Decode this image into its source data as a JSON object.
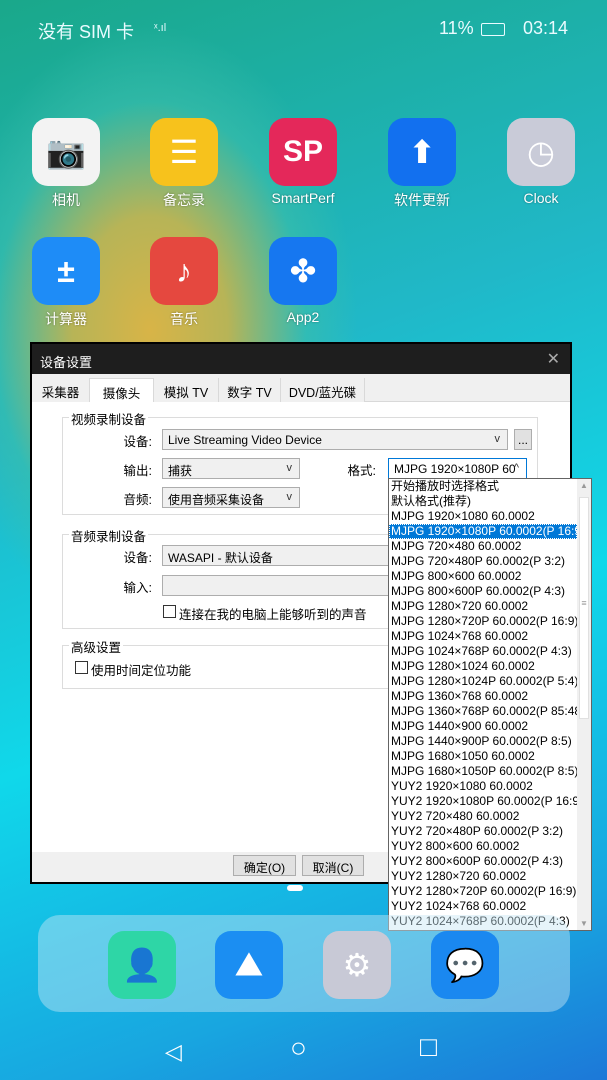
{
  "status_bar": {
    "carrier": "没有 SIM 卡",
    "battery": "11%",
    "time": "03:14"
  },
  "apps": [
    {
      "label": "相机",
      "icon": "camera-icon",
      "color": "#f3f3f3"
    },
    {
      "label": "备忘录",
      "icon": "notepad-icon",
      "color": "#f7c21c"
    },
    {
      "label": "SmartPerf",
      "icon": "smartperf-icon",
      "color": "#e4285a",
      "glyph": "SP"
    },
    {
      "label": "软件更新",
      "icon": "upload-arrow-icon",
      "color": "#1270ef"
    },
    {
      "label": "Clock",
      "icon": "clock-icon",
      "color": "#c9cbd8"
    },
    {
      "label": "计算器",
      "icon": "calculator-icon",
      "color": "#1e8cf7"
    },
    {
      "label": "音乐",
      "icon": "music-icon",
      "color": "#e5483f"
    },
    {
      "label": "App2",
      "icon": "grid-app-icon",
      "color": "#1677f0"
    }
  ],
  "dialog": {
    "title": "设备设置",
    "tabs": [
      "采集器",
      "摄像头",
      "模拟 TV",
      "数字 TV",
      "DVD/蓝光碟"
    ],
    "video_group": {
      "title": "视频录制设备",
      "device_label": "设备:",
      "device_value": "Live Streaming Video Device",
      "more_button": "...",
      "output_label": "输出:",
      "output_value": "捕获",
      "format_label": "格式:",
      "format_value": "MJPG 1920×1080P 60",
      "audio_label": "音频:",
      "audio_value": "使用音频采集设备"
    },
    "audio_group": {
      "title": "音频录制设备",
      "device_label": "设备:",
      "device_value": "WASAPI - 默认设备",
      "input_label": "输入:",
      "input_value": "",
      "checkbox_label": "连接在我的电脑上能够听到的声音",
      "checked": false
    },
    "advanced_group": {
      "title": "高级设置",
      "checkbox_label": "使用时间定位功能",
      "checked": false
    },
    "ok_button": "确定(O)",
    "cancel_button": "取消(C)"
  },
  "format_list": {
    "selected_index": 3,
    "items": [
      "开始播放时选择格式",
      "默认格式(推荐)",
      "MJPG 1920×1080 60.0002",
      "MJPG 1920×1080P 60.0002(P 16:9)",
      "MJPG 720×480 60.0002",
      "MJPG 720×480P 60.0002(P 3:2)",
      "MJPG 800×600 60.0002",
      "MJPG 800×600P 60.0002(P 4:3)",
      "MJPG 1280×720 60.0002",
      "MJPG 1280×720P 60.0002(P 16:9)",
      "MJPG 1024×768 60.0002",
      "MJPG 1024×768P 60.0002(P 4:3)",
      "MJPG 1280×1024 60.0002",
      "MJPG 1280×1024P 60.0002(P 5:4)",
      "MJPG 1360×768 60.0002",
      "MJPG 1360×768P 60.0002(P 85:48)",
      "MJPG 1440×900 60.0002",
      "MJPG 1440×900P 60.0002(P 8:5)",
      "MJPG 1680×1050 60.0002",
      "MJPG 1680×1050P 60.0002(P 8:5)",
      "YUY2 1920×1080 60.0002",
      "YUY2 1920×1080P 60.0002(P 16:9)",
      "YUY2 720×480 60.0002",
      "YUY2 720×480P 60.0002(P 3:2)",
      "YUY2 800×600 60.0002",
      "YUY2 800×600P 60.0002(P 4:3)",
      "YUY2 1280×720 60.0002",
      "YUY2 1280×720P 60.0002(P 16:9)",
      "YUY2 1024×768 60.0002",
      "YUY2 1024×768P 60.0002(P 4:3)"
    ]
  },
  "dock": [
    {
      "icon": "contacts-icon",
      "color": "#2ed6a6"
    },
    {
      "icon": "gallery-icon",
      "color": "#1b8ef2"
    },
    {
      "icon": "settings-icon",
      "color": "#c8c9d6"
    },
    {
      "icon": "messages-icon",
      "color": "#1a88f0"
    }
  ],
  "nav": {
    "back": "◁",
    "home": "○",
    "recents": "□"
  }
}
